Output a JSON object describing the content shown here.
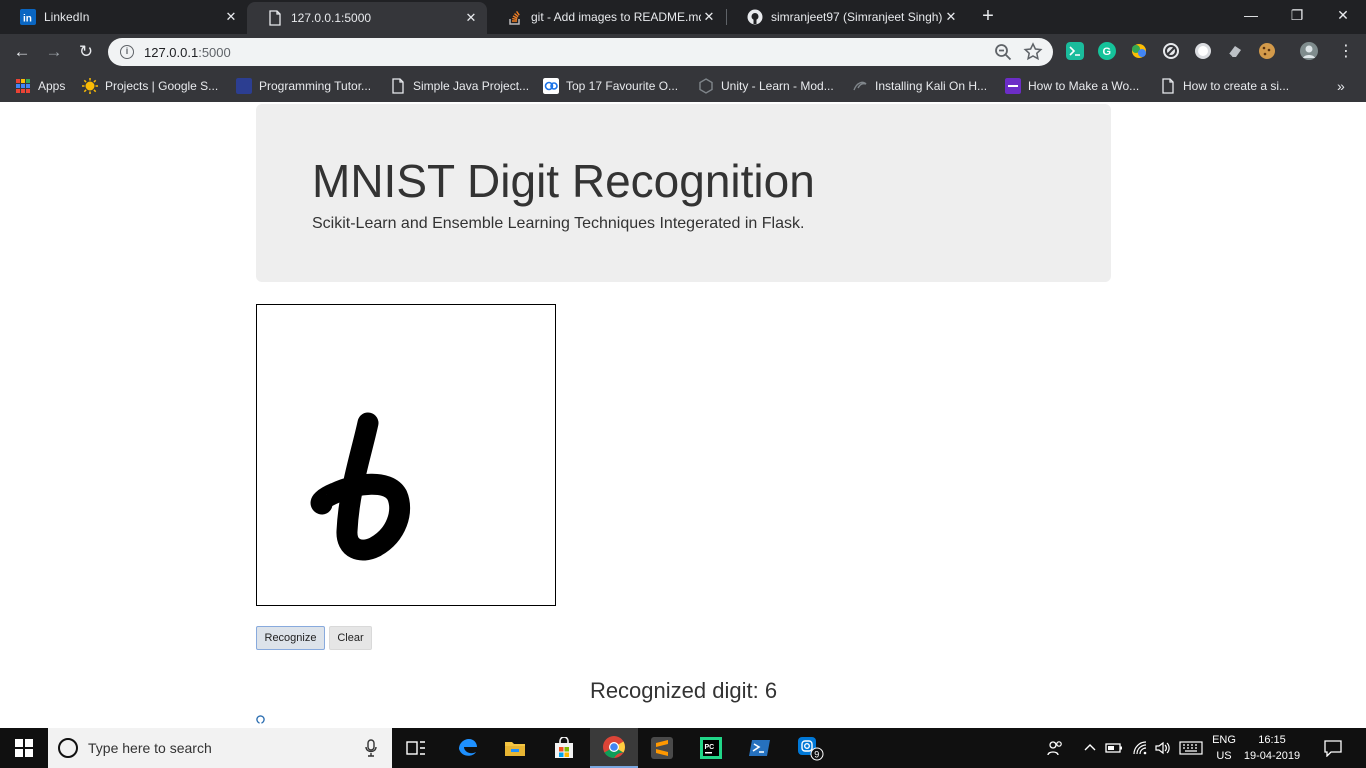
{
  "browser": {
    "tabs": [
      {
        "title": "LinkedIn",
        "active": false
      },
      {
        "title": "127.0.0.1:5000",
        "active": true
      },
      {
        "title": "git - Add images to README.md",
        "active": false
      },
      {
        "title": "simranjeet97 (Simranjeet Singh)",
        "active": false
      }
    ],
    "close_glyph": "✕",
    "new_tab_glyph": "+",
    "window_controls": {
      "minimize": "—",
      "restore": "❐",
      "close": "✕"
    },
    "nav": {
      "back": "←",
      "forward": "→",
      "reload": "↻"
    },
    "address": {
      "host": "127.0.0.1",
      "port": ":5000",
      "info_glyph": "i"
    },
    "bookmarks": [
      {
        "label": "Apps",
        "icon": "apps-grid-icon"
      },
      {
        "label": "Projects | Google S...",
        "icon": "google-sun-icon"
      },
      {
        "label": "Programming Tutor...",
        "icon": "tutorial-icon"
      },
      {
        "label": "Simple Java Project...",
        "icon": "page-icon"
      },
      {
        "label": "Top 17 Favourite O...",
        "icon": "site-icon"
      },
      {
        "label": "Unity - Learn - Mod...",
        "icon": "unity-icon"
      },
      {
        "label": "Installing Kali On H...",
        "icon": "kali-icon"
      },
      {
        "label": "How to Make a Wo...",
        "icon": "colorlib-icon"
      },
      {
        "label": "How to create a si...",
        "icon": "page-icon"
      }
    ],
    "bookmarks_overflow": "»"
  },
  "page": {
    "title": "MNIST Digit Recognition",
    "subtitle": "Scikit-Learn and Ensemble Learning Techniques Integerated in Flask.",
    "recognize_label": "Recognize",
    "clear_label": "Clear",
    "result_text": "Recognized digit: 6"
  },
  "taskbar": {
    "search_placeholder": "Type here to search",
    "lang_line1": "ENG",
    "lang_line2": "US",
    "time": "16:15",
    "date": "19-04-2019",
    "notification_count": "9"
  },
  "colors": {
    "chrome_dark": "#202124",
    "chrome_toolbar": "#35363a",
    "jumbotron_bg": "#eeeeee",
    "taskbar_bg": "#101010"
  }
}
